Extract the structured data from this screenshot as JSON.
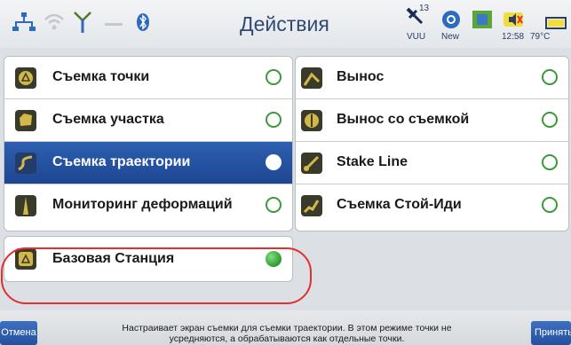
{
  "header": {
    "title": "Действия",
    "icons": [
      "network-icon",
      "wifi-icon",
      "antenna-icon",
      "signal-icon",
      "bluetooth-icon",
      "satellite-icon",
      "vuu-icon",
      "new-icon",
      "map-icon",
      "speaker-icon",
      "battery-icon"
    ],
    "satellite_count": "13",
    "vuu_label": "VUU",
    "new_label": "New",
    "time": "12:58",
    "temperature": "79°C"
  },
  "left_panel": {
    "items": [
      {
        "label": "Съемка точки",
        "icon": "survey-point-icon"
      },
      {
        "label": "Съемка участка",
        "icon": "survey-area-icon"
      },
      {
        "label": "Съемка траектории",
        "icon": "survey-trajectory-icon",
        "selected": true
      },
      {
        "label": "Мониторинг деформаций",
        "icon": "deformation-monitor-icon"
      }
    ]
  },
  "right_panel": {
    "items": [
      {
        "label": "Вынос",
        "icon": "stakeout-icon"
      },
      {
        "label": "Вынос со съемкой",
        "icon": "stakeout-survey-icon"
      },
      {
        "label": "Stake Line",
        "icon": "stake-line-icon"
      },
      {
        "label": "Съемка Стой-Иди",
        "icon": "stop-go-icon"
      }
    ]
  },
  "base_station": {
    "label": "Базовая Станция",
    "icon": "base-station-icon",
    "status_color": "#2e9a2e"
  },
  "footer": {
    "cancel_label": "Отмена",
    "accept_label": "Принять",
    "hint_line1": "Настраивает экран съемки для съемки траектории. В этом режиме точки не",
    "hint_line2": "усредняются, а обрабатываются как отдельные точки."
  },
  "colors": {
    "accent": "#1d4692",
    "radio": "#3a9a3a",
    "highlight": "#e0302f",
    "title": "#2e4a75"
  }
}
